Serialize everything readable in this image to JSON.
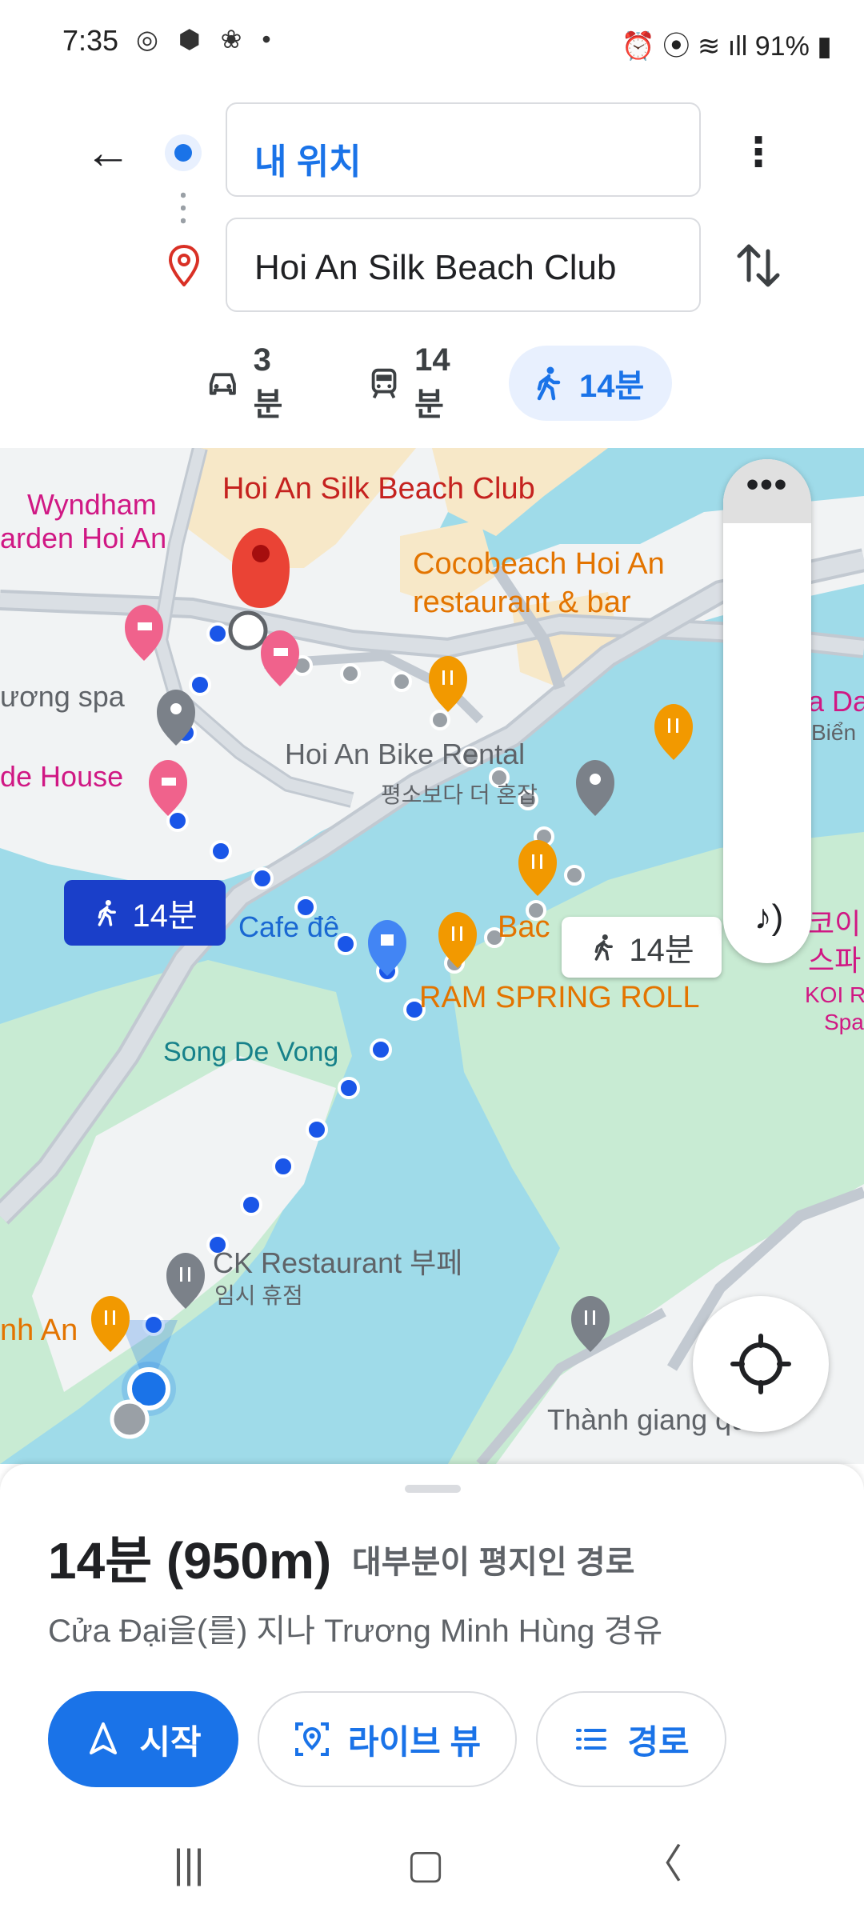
{
  "status_bar": {
    "time": "7:35",
    "left_icons": "◎ ⬢ ❀ •",
    "right_icons": "⏰ ⦿ ≋ ıll",
    "battery": "91%"
  },
  "directions": {
    "origin": "내 위치",
    "destination": "Hoi An Silk Beach Club"
  },
  "modes": [
    {
      "icon": "car-icon",
      "label": "3분"
    },
    {
      "icon": "train-icon",
      "label": "14분"
    },
    {
      "icon": "walk-icon",
      "label": "14분",
      "selected": true
    }
  ],
  "map": {
    "labels": {
      "silk_beach": "Hoi An Silk Beach Club",
      "wyndham_1": "Wyndham",
      "wyndham_2": "arden Hoi An",
      "cocobeach_1": "Cocobeach Hoi An",
      "cocobeach_2": "restaurant & bar",
      "spa": "ương spa",
      "bike_rental": "Hoi An Bike Rental",
      "bike_rental_sub": "평소보다 더 혼잡",
      "house": "de House",
      "cafe": "Cafe đê",
      "bac": "Bac",
      "spring_roll": "RAM SPRING ROLL",
      "song_de_vong": "Song De Vong",
      "ck_restaurant": "CK Restaurant 부페",
      "ck_sub": "임시 휴점",
      "nh_an": "nh An",
      "thanh_giang": "Thành giang quán",
      "right_da": "a Da",
      "right_bien": "Biển",
      "koi_1": "코이 리",
      "koi_2": "스파",
      "koi_3": "KOI Re",
      "koi_4": "Spa"
    },
    "route_badge": "14분",
    "route_badge_alt": "14분",
    "side_panel_more": "•••"
  },
  "route_summary": {
    "duration_distance": "14분 (950m)",
    "note": "대부분이 평지인 경로",
    "via": "Cửa Đại을(를) 지나 Trương Minh Hùng 경유"
  },
  "actions": {
    "start": "시작",
    "live_view": "라이브 뷰",
    "steps": "경로"
  },
  "colors": {
    "accent": "#1a73e8",
    "route_dots": "#1a56e8",
    "water": "#9fdbe9",
    "land": "#f1f3f4",
    "park": "#c8ebd3",
    "sand": "#f7e8c8"
  }
}
